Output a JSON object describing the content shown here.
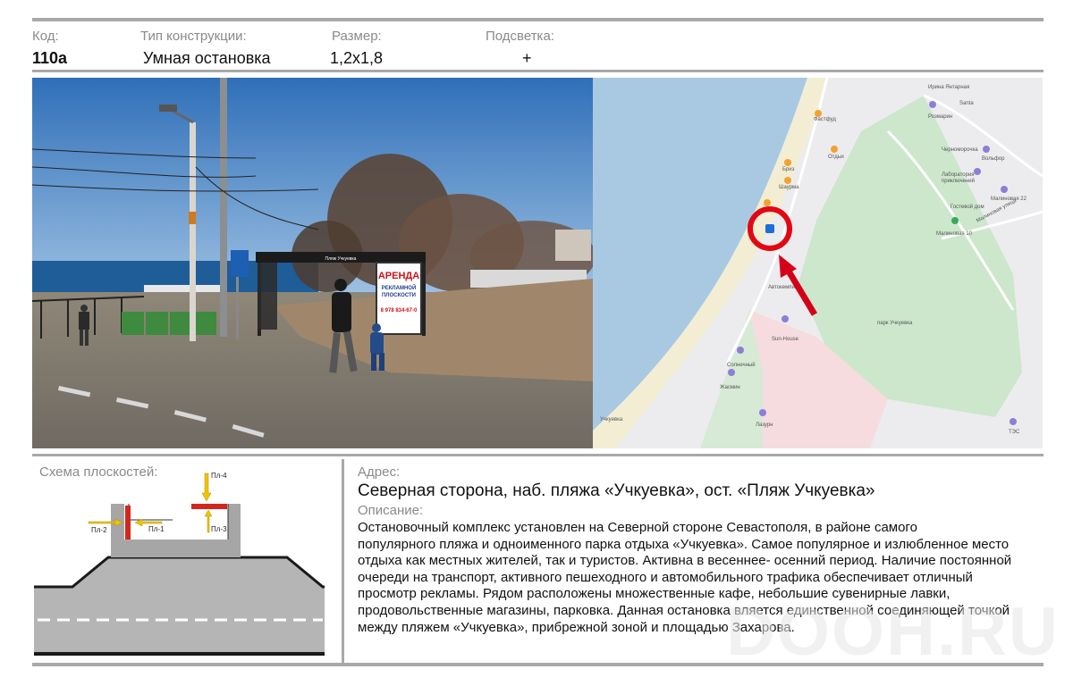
{
  "header": {
    "code_label": "Код:",
    "type_label": "Тип конструкции:",
    "size_label": "Размер:",
    "light_label": "Подсветка:",
    "code_value": "110а",
    "type_value": "Умная остановка",
    "size_value": "1,2х1,8",
    "light_value": "+"
  },
  "photo": {
    "shelter_sign": "Пляж Учкуевка",
    "billboard_title": "АРЕНДА",
    "billboard_sub1": "РЕКЛАМНОЙ",
    "billboard_sub2": "ПЛОСКОСТИ",
    "billboard_phone": "8 978 834-67-0"
  },
  "map": {
    "labels": {
      "fastfood": "Фастфуд",
      "otdyh": "Отдых",
      "briz": "Бриз",
      "shaurma": "Шаурма",
      "avtokemping": "Автокемпинг",
      "sunhouse": "Sun-House",
      "solnechny": "Солнечный",
      "zhasmin": "Жасмин",
      "lazurnyi": "Лазурн",
      "uchkuevka": "Учкуевка",
      "park": "парк Учкуевка",
      "malinovaya10": "Малиновая 10",
      "malinovaya22": "Малиновая 22",
      "gostevoy": "Гостевой дом",
      "volfor": "Вольфор",
      "laboratoriya": "Лаборатория",
      "priklyucheniy": "приключений",
      "chernomorochka": "Черноморочка",
      "rozmarin": "Розмарин",
      "santa": "Santa",
      "irina": "Ирина Янтарная",
      "malinovaya_street": "Малиновая улица",
      "tes": "ТЭС"
    },
    "colors": {
      "water": "#a9c9e3",
      "beach": "#f3eed3",
      "park": "#cce7cc",
      "residential": "#ececee",
      "pink": "#f6dcdf",
      "marker": "#e30613",
      "arrow": "#d4001a"
    }
  },
  "schema": {
    "title": "Схема плоскостей:",
    "planes": [
      "Пл-1",
      "Пл-2",
      "Пл-3",
      "Пл-4"
    ]
  },
  "address": {
    "label": "Адрес:",
    "value": "Северная сторона, наб. пляжа «Учкуевка», ост. «Пляж Учкуевка»"
  },
  "description": {
    "label": "Описание:",
    "lines": [
      "Остановочный  комплекс установлен  на Северной стороне Севастополя, в районе самого",
      "популярного пляжа  и одноименного парка  отдыха «Учкуевка». Самое популярное  и излюбленное место",
      "отдыха как местных жителей, так и туристов. Активна в весеннее- осенний период.  Наличие постоянной",
      "очереди на транспорт, активного пешеходного и автомобильного  трафика  обеспечивает отличный",
      "просмотр рекламы.  Рядом расположены  множественные кафе, небольшие сувенирные лавки,",
      "продовольственные магазины, парковка.  Данная остановка вляется единственной  соединяющей точкой",
      "между пляжем «Учкуевка», прибрежной зоной и  площадью Захарова."
    ]
  },
  "watermark": "DOOH.RU"
}
